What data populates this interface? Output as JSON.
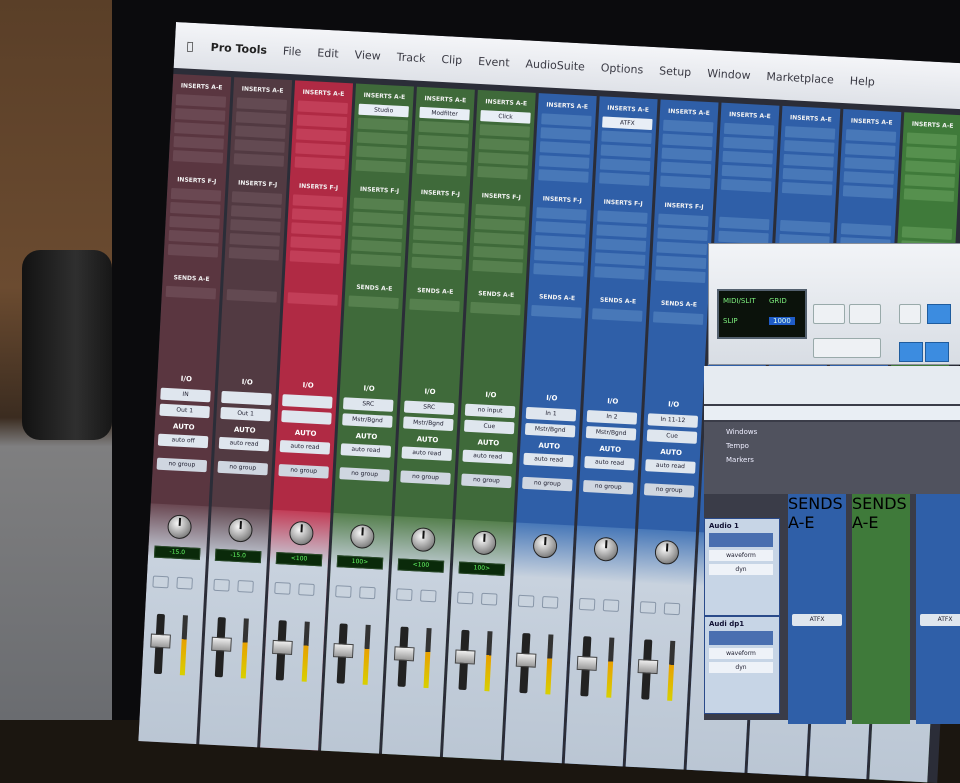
{
  "menubar": {
    "app_name": "Pro Tools",
    "items": [
      "File",
      "Edit",
      "View",
      "Track",
      "Clip",
      "Event",
      "AudioSuite",
      "Options",
      "Setup",
      "Window",
      "Marketplace",
      "Help"
    ]
  },
  "strips": [
    {
      "color": "#5a3640",
      "slot": "#6a4852",
      "ins1": "INSERTS A-E",
      "ins2": "INSERTS F-J",
      "sends": "SENDS A-E",
      "plug1": "",
      "io": "I/O",
      "in": "IN",
      "out": "Out 1",
      "auto_label": "AUTO",
      "auto": "auto off",
      "group": "no group"
    },
    {
      "color": "#523a42",
      "slot": "#634a52",
      "ins1": "INSERTS A-E",
      "ins2": "INSERTS F-J",
      "sends": "",
      "plug1": "",
      "io": "I/O",
      "in": "",
      "out": "Out 1",
      "auto_label": "AUTO",
      "auto": "auto read",
      "group": "no group"
    },
    {
      "color": "#b02a44",
      "slot": "#c23e58",
      "ins1": "INSERTS A-E",
      "ins2": "INSERTS F-J",
      "sends": "",
      "plug1": "",
      "io": "I/O",
      "in": "",
      "out": "",
      "auto_label": "AUTO",
      "auto": "auto read",
      "group": "no group"
    },
    {
      "color": "#3f6a3a",
      "slot": "#56804e",
      "ins1": "INSERTS A-E",
      "ins2": "INSERTS F-J",
      "sends": "SENDS A-E",
      "plug1": "Studio",
      "io": "I/O",
      "in": "SRC",
      "out": "Mstr/Bgnd",
      "auto_label": "AUTO",
      "auto": "auto read",
      "group": "no group"
    },
    {
      "color": "#3f6a3a",
      "slot": "#56804e",
      "ins1": "INSERTS A-E",
      "ins2": "INSERTS F-J",
      "sends": "SENDS A-E",
      "plug1": "Modfilter",
      "io": "I/O",
      "in": "SRC",
      "out": "Mstr/Bgnd",
      "auto_label": "AUTO",
      "auto": "auto read",
      "group": "no group"
    },
    {
      "color": "#3f6a3a",
      "slot": "#56804e",
      "ins1": "INSERTS A-E",
      "ins2": "INSERTS F-J",
      "sends": "SENDS A-E",
      "plug1": "Click",
      "io": "I/O",
      "in": "no input",
      "out": "Cue",
      "auto_label": "AUTO",
      "auto": "auto read",
      "group": "no group"
    },
    {
      "color": "#2f5fa8",
      "slot": "#4878b8",
      "ins1": "INSERTS A-E",
      "ins2": "INSERTS F-J",
      "sends": "SENDS A-E",
      "plug1": "",
      "io": "I/O",
      "in": "In 1",
      "out": "Mstr/Bgnd",
      "auto_label": "AUTO",
      "auto": "auto read",
      "group": "no group"
    },
    {
      "color": "#2f5fa8",
      "slot": "#4878b8",
      "ins1": "INSERTS A-E",
      "ins2": "INSERTS F-J",
      "sends": "SENDS A-E",
      "plug1": "ATFX",
      "io": "I/O",
      "in": "In 2",
      "out": "Mstr/Bgnd",
      "auto_label": "AUTO",
      "auto": "auto read",
      "group": "no group"
    },
    {
      "color": "#2f5fa8",
      "slot": "#4878b8",
      "ins1": "INSERTS A-E",
      "ins2": "INSERTS F-J",
      "sends": "SENDS A-E",
      "plug1": "",
      "io": "I/O",
      "in": "In 11-12",
      "out": "Cue",
      "auto_label": "AUTO",
      "auto": "auto read",
      "group": "no group"
    },
    {
      "color": "#2f5fa8",
      "slot": "#4878b8",
      "ins1": "INSERTS A-E",
      "ins2": "",
      "sends": "",
      "plug1": "",
      "io": "",
      "in": "",
      "out": "",
      "auto_label": "",
      "auto": "",
      "group": ""
    },
    {
      "color": "#2f5fa8",
      "slot": "#4878b8",
      "ins1": "INSERTS A-E",
      "ins2": "",
      "sends": "",
      "plug1": "",
      "io": "",
      "in": "",
      "out": "",
      "auto_label": "",
      "auto": "",
      "group": ""
    },
    {
      "color": "#2f5fa8",
      "slot": "#4878b8",
      "ins1": "INSERTS A-E",
      "ins2": "",
      "sends": "",
      "plug1": "",
      "io": "",
      "in": "",
      "out": "",
      "auto_label": "",
      "auto": "",
      "group": ""
    },
    {
      "color": "#3f7a3a",
      "slot": "#56904e",
      "ins1": "INSERTS A-E",
      "ins2": "",
      "sends": "",
      "plug1": "",
      "io": "",
      "in": "",
      "out": "",
      "auto_label": "",
      "auto": "",
      "group": ""
    }
  ],
  "pan_values": [
    "-15.0",
    "-15.0",
    "<100",
    "100>",
    "<100",
    "100>"
  ],
  "transport": {
    "counter_a": "MIDI/SLIT",
    "counter_b": "GRID",
    "counter_c": "SLIP",
    "counter_d": "1000"
  },
  "edit": {
    "list": [
      "Windows",
      "Tempo",
      "Markers"
    ],
    "tracks": [
      {
        "name": "Audio 1",
        "b1": "waveform",
        "b2": "dyn"
      },
      {
        "name": "Audi dp1",
        "b1": "waveform",
        "b2": "dyn"
      }
    ],
    "edit_strip_labels": [
      "SENDS A-E",
      "SENDS A-E"
    ],
    "edit_strip_io": [
      "ATFX",
      "ATFX"
    ]
  },
  "colors": {
    "menubar": "#e8ebf0",
    "screen_bg": "#2b2d38"
  }
}
